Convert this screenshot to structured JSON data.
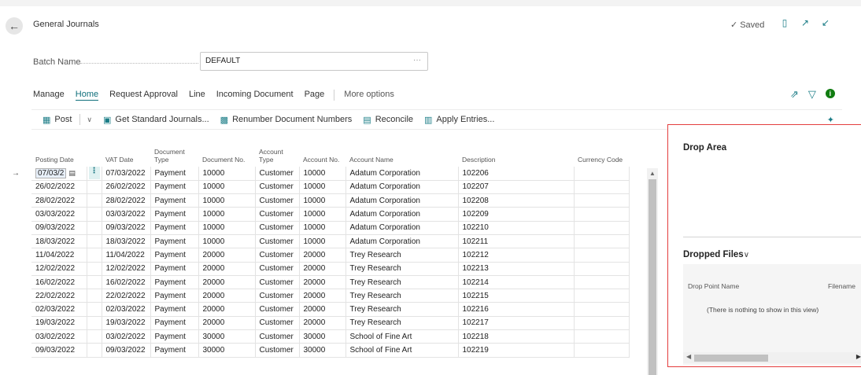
{
  "header": {
    "title": "General Journals",
    "saved_text": "Saved",
    "icons": [
      "bookmark-icon",
      "open-new-window-icon",
      "collapse-icon"
    ]
  },
  "batch": {
    "label": "Batch Name",
    "value": "DEFAULT",
    "lookup": "···"
  },
  "menu": {
    "items": [
      "Manage",
      "Home",
      "Request Approval",
      "Line",
      "Incoming Document",
      "Page"
    ],
    "active": "Home",
    "more": "More options"
  },
  "actions": {
    "post": "Post",
    "get_standard": "Get Standard Journals...",
    "renumber": "Renumber Document Numbers",
    "reconcile": "Reconcile",
    "apply": "Apply Entries..."
  },
  "grid": {
    "columns": [
      "Posting Date",
      "VAT Date",
      "Document Type",
      "Document No.",
      "Account Type",
      "Account No.",
      "Account Name",
      "Description",
      "Currency Code"
    ],
    "rows": [
      [
        "07/03/2",
        "07/03/2022",
        "Payment",
        "10000",
        "Customer",
        "10000",
        "Adatum Corporation",
        "102206",
        ""
      ],
      [
        "26/02/2022",
        "26/02/2022",
        "Payment",
        "10000",
        "Customer",
        "10000",
        "Adatum Corporation",
        "102207",
        ""
      ],
      [
        "28/02/2022",
        "28/02/2022",
        "Payment",
        "10000",
        "Customer",
        "10000",
        "Adatum Corporation",
        "102208",
        ""
      ],
      [
        "03/03/2022",
        "03/03/2022",
        "Payment",
        "10000",
        "Customer",
        "10000",
        "Adatum Corporation",
        "102209",
        ""
      ],
      [
        "09/03/2022",
        "09/03/2022",
        "Payment",
        "10000",
        "Customer",
        "10000",
        "Adatum Corporation",
        "102210",
        ""
      ],
      [
        "18/03/2022",
        "18/03/2022",
        "Payment",
        "10000",
        "Customer",
        "10000",
        "Adatum Corporation",
        "102211",
        ""
      ],
      [
        "11/04/2022",
        "11/04/2022",
        "Payment",
        "20000",
        "Customer",
        "20000",
        "Trey Research",
        "102212",
        ""
      ],
      [
        "12/02/2022",
        "12/02/2022",
        "Payment",
        "20000",
        "Customer",
        "20000",
        "Trey Research",
        "102213",
        ""
      ],
      [
        "16/02/2022",
        "16/02/2022",
        "Payment",
        "20000",
        "Customer",
        "20000",
        "Trey Research",
        "102214",
        ""
      ],
      [
        "22/02/2022",
        "22/02/2022",
        "Payment",
        "20000",
        "Customer",
        "20000",
        "Trey Research",
        "102215",
        ""
      ],
      [
        "02/03/2022",
        "02/03/2022",
        "Payment",
        "20000",
        "Customer",
        "20000",
        "Trey Research",
        "102216",
        ""
      ],
      [
        "19/03/2022",
        "19/03/2022",
        "Payment",
        "20000",
        "Customer",
        "20000",
        "Trey Research",
        "102217",
        ""
      ],
      [
        "03/02/2022",
        "03/02/2022",
        "Payment",
        "30000",
        "Customer",
        "30000",
        "School of Fine Art",
        "102218",
        ""
      ],
      [
        "09/03/2022",
        "09/03/2022",
        "Payment",
        "30000",
        "Customer",
        "30000",
        "School of Fine Art",
        "102219",
        ""
      ]
    ]
  },
  "panel": {
    "drop_title": "Drop Area",
    "files_title": "Dropped Files",
    "col1": "Drop Point Name",
    "col2": "Filename",
    "empty_text": "(There is nothing to show in this view)",
    "highlight_color": "#e43d3d"
  },
  "colors": {
    "accent": "#0f6f7b",
    "info": "#107c10"
  }
}
